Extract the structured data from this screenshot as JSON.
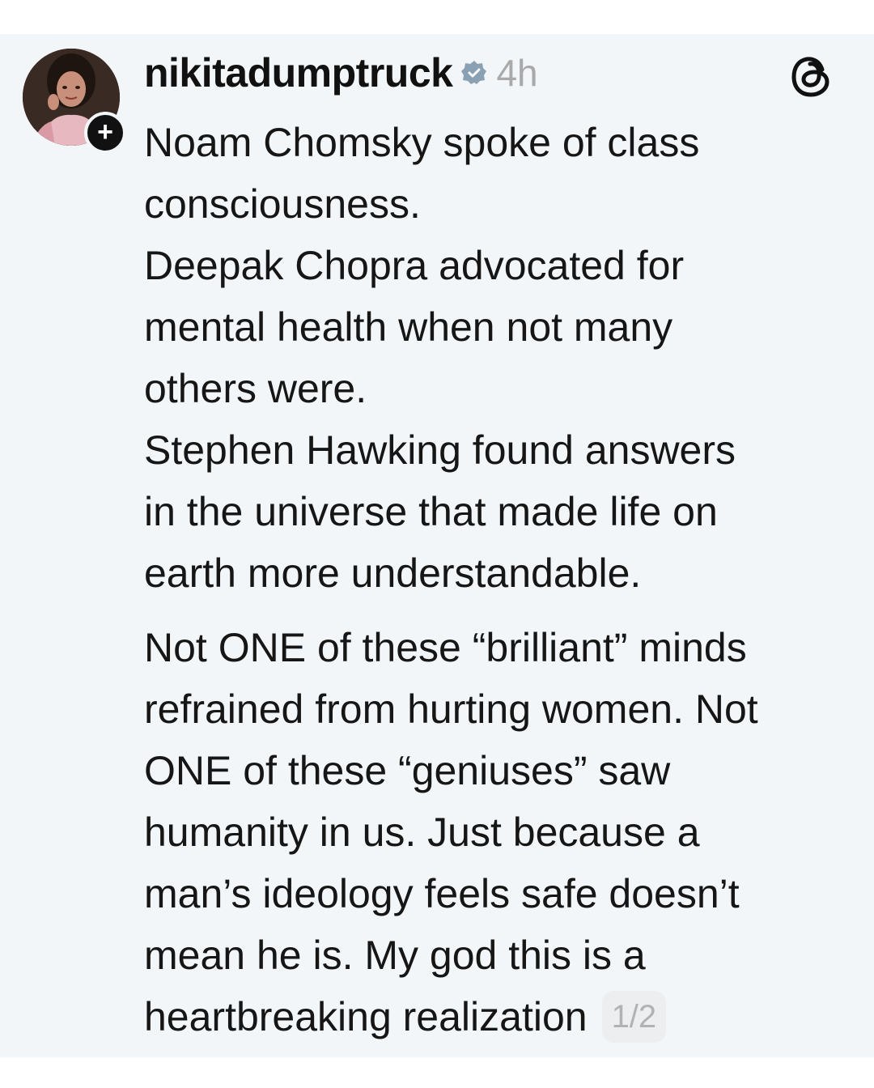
{
  "post": {
    "username": "nikitadumptruck",
    "timestamp": "4h",
    "verified": true,
    "follow_icon": "plus-icon",
    "app_icon": "threads-logo-icon",
    "lines": [
      "Noam Chomsky spoke of class",
      "consciousness.",
      "Deepak Chopra advocated for",
      "mental health when not many",
      "others were.",
      "Stephen Hawking found answers",
      "in the universe that made life on",
      "earth more understandable.",
      "Not ONE of these “brilliant” minds",
      "refrained from hurting women. Not",
      "ONE of these “geniuses” saw",
      "humanity in us. Just because a",
      "man’s ideology feels safe doesn’t",
      "mean he is. My god this is a",
      "heartbreaking realization"
    ],
    "page_indicator": "1/2"
  },
  "colors": {
    "background": "#f3f6f8",
    "text": "#161616",
    "muted": "#a9a9a9",
    "verified_badge": "#8aa0b3"
  }
}
